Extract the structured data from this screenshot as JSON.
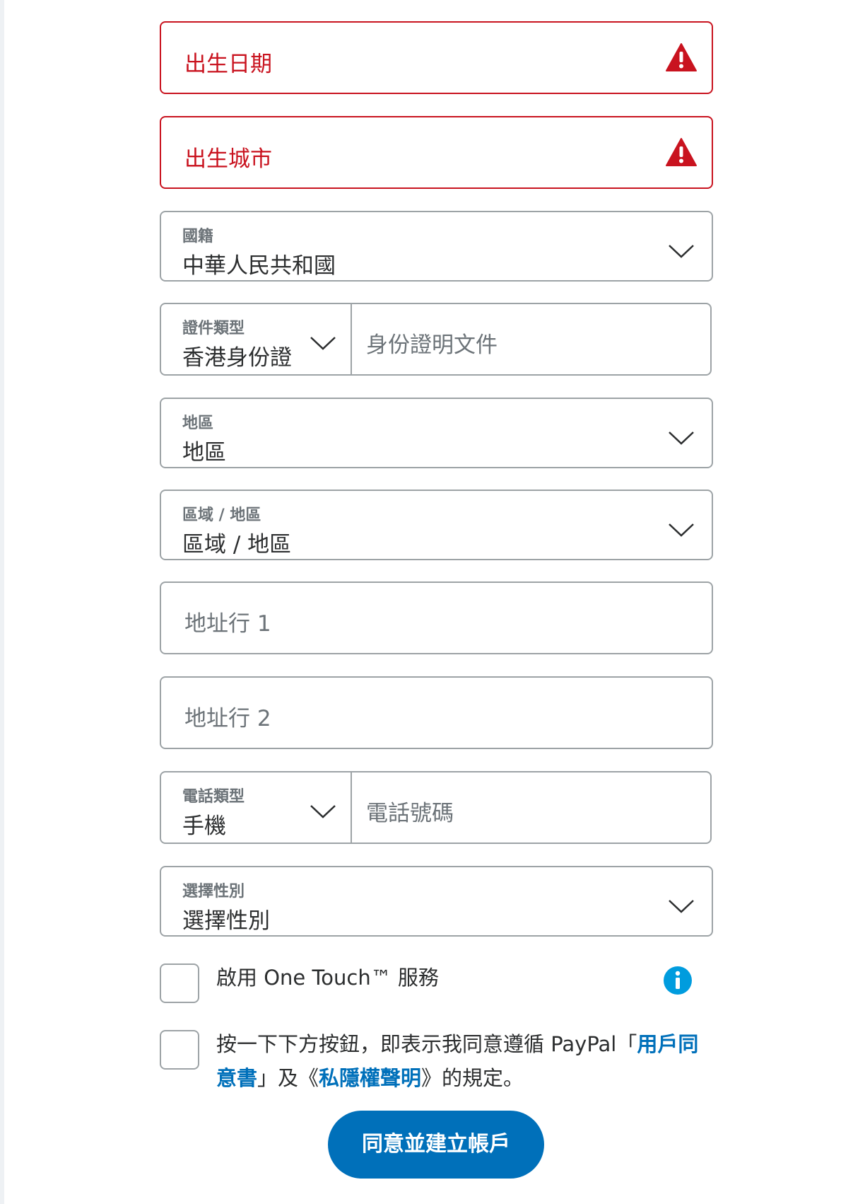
{
  "colors": {
    "error": "#c9131f",
    "border": "#9da3a6",
    "primary": "#0070ba",
    "muted": "#6c7378",
    "text": "#2c2e2f"
  },
  "birth_date": {
    "placeholder": "出生日期",
    "icon": "warning-icon"
  },
  "birth_city": {
    "placeholder": "出生城市",
    "icon": "warning-icon"
  },
  "nationality": {
    "label": "國籍",
    "value": "中華人民共和國"
  },
  "id_doc": {
    "type_label": "證件類型",
    "type_value": "香港身份證",
    "number_placeholder": "身份證明文件"
  },
  "district": {
    "label": "地區",
    "value": "地區"
  },
  "region": {
    "label": "區域 / 地區",
    "value": "區域 / 地區"
  },
  "address1": {
    "placeholder": "地址行 1"
  },
  "address2": {
    "placeholder": "地址行 2"
  },
  "phone": {
    "type_label": "電話類型",
    "type_value": "手機",
    "number_placeholder": "電話號碼"
  },
  "gender": {
    "label": "選擇性別",
    "value": "選擇性別"
  },
  "one_touch": {
    "label": "啟用 One Touch™ 服務",
    "icon": "info-icon"
  },
  "agreement": {
    "text_before": "按一下下方按鈕，即表示我同意遵循 PayPal「",
    "link_user_agreement": "用戶同意書",
    "text_middle": "」及《",
    "link_privacy": "私隱權聲明",
    "text_after": "》的規定。"
  },
  "submit": {
    "label": "同意並建立帳戶"
  }
}
